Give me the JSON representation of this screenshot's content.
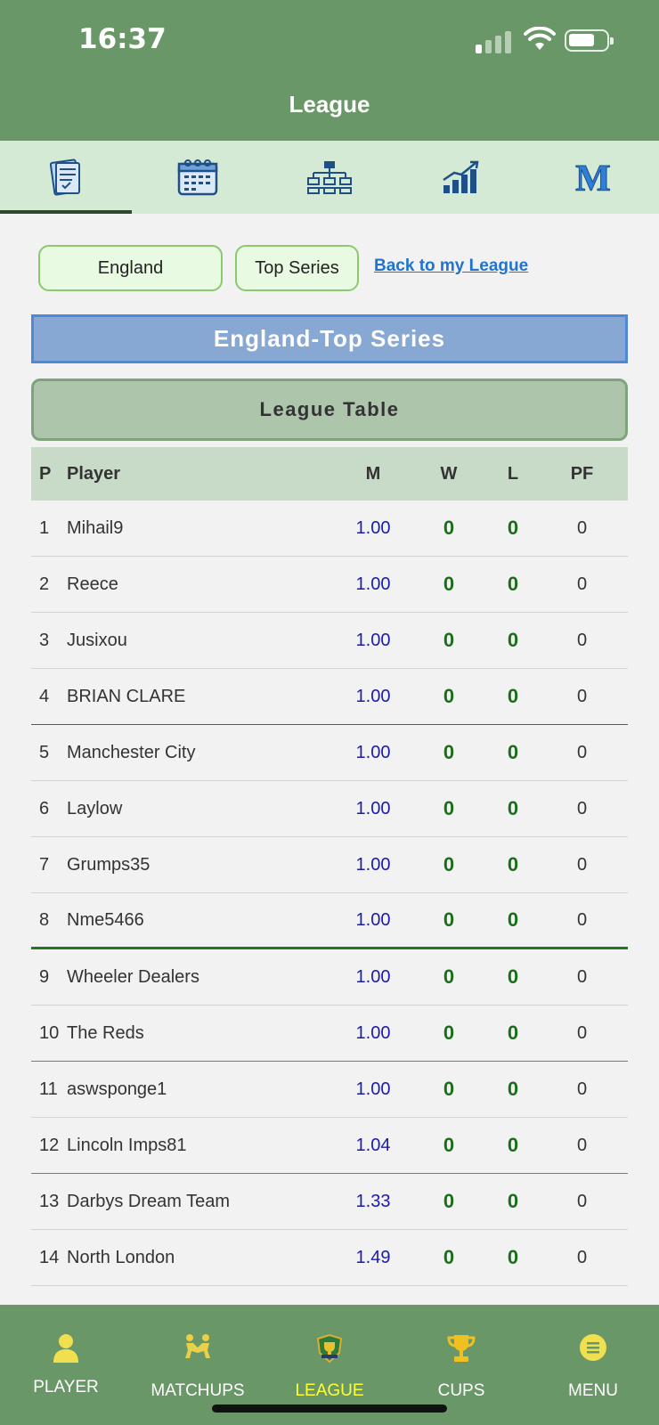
{
  "status_bar": {
    "time": "16:37"
  },
  "header": {
    "title": "League"
  },
  "tabs": [
    {
      "icon": "scorecard-icon",
      "active": true
    },
    {
      "icon": "calendar-icon",
      "active": false
    },
    {
      "icon": "bracket-icon",
      "active": false
    },
    {
      "icon": "stats-chart-icon",
      "active": false
    },
    {
      "icon": "m-logo-icon",
      "active": false
    }
  ],
  "filters": {
    "country": "England",
    "division": "Top Series",
    "back_link": "Back to my League"
  },
  "league_title": "England-Top Series",
  "table_button": "League Table",
  "table": {
    "headers": {
      "p": "P",
      "player": "Player",
      "m": "M",
      "w": "W",
      "l": "L",
      "pf": "PF"
    },
    "rows": [
      {
        "p": "1",
        "player": "Mihail9",
        "m": "1.00",
        "w": "0",
        "l": "0",
        "pf": "0"
      },
      {
        "p": "2",
        "player": "Reece",
        "m": "1.00",
        "w": "0",
        "l": "0",
        "pf": "0"
      },
      {
        "p": "3",
        "player": "Jusixou",
        "m": "1.00",
        "w": "0",
        "l": "0",
        "pf": "0"
      },
      {
        "p": "4",
        "player": "BRIAN CLARE",
        "m": "1.00",
        "w": "0",
        "l": "0",
        "pf": "0"
      },
      {
        "p": "5",
        "player": "Manchester City",
        "m": "1.00",
        "w": "0",
        "l": "0",
        "pf": "0"
      },
      {
        "p": "6",
        "player": "Laylow",
        "m": "1.00",
        "w": "0",
        "l": "0",
        "pf": "0"
      },
      {
        "p": "7",
        "player": "Grumps35",
        "m": "1.00",
        "w": "0",
        "l": "0",
        "pf": "0"
      },
      {
        "p": "8",
        "player": "Nme5466",
        "m": "1.00",
        "w": "0",
        "l": "0",
        "pf": "0"
      },
      {
        "p": "9",
        "player": "Wheeler Dealers",
        "m": "1.00",
        "w": "0",
        "l": "0",
        "pf": "0"
      },
      {
        "p": "10",
        "player": "The Reds",
        "m": "1.00",
        "w": "0",
        "l": "0",
        "pf": "0"
      },
      {
        "p": "11",
        "player": "aswsponge1",
        "m": "1.00",
        "w": "0",
        "l": "0",
        "pf": "0"
      },
      {
        "p": "12",
        "player": "Lincoln Imps81",
        "m": "1.04",
        "w": "0",
        "l": "0",
        "pf": "0"
      },
      {
        "p": "13",
        "player": "Darbys Dream Team",
        "m": "1.33",
        "w": "0",
        "l": "0",
        "pf": "0"
      },
      {
        "p": "14",
        "player": "North London",
        "m": "1.49",
        "w": "0",
        "l": "0",
        "pf": "0"
      }
    ]
  },
  "bottom_nav": [
    {
      "label": "PLAYER",
      "icon": "player-icon",
      "active": false
    },
    {
      "label": "MATCHUPS",
      "icon": "matchups-icon",
      "active": false
    },
    {
      "label": "LEAGUE",
      "icon": "league-badge-icon",
      "active": true
    },
    {
      "label": "CUPS",
      "icon": "trophy-icon",
      "active": false
    },
    {
      "label": "MENU",
      "icon": "menu-icon",
      "active": false
    }
  ],
  "colors": {
    "header_bg": "#6a9767",
    "tabbar_bg": "#d4ead4",
    "banner_bg": "#87a8d2",
    "accent_link": "#1e74d0",
    "active_nav": "#ffff33"
  }
}
